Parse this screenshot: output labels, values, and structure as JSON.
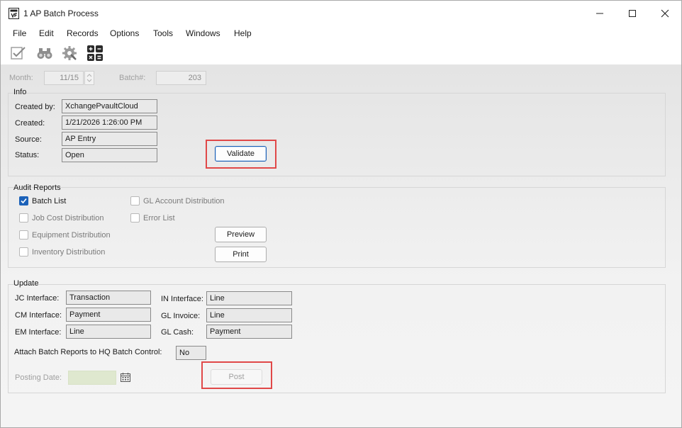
{
  "window": {
    "title": "1 AP Batch Process"
  },
  "menu": [
    "File",
    "Edit",
    "Records",
    "Options",
    "Tools",
    "Windows",
    "Help"
  ],
  "toolbar": {
    "icons": [
      "checklist-icon",
      "binoculars-icon",
      "gear-icon",
      "calculator-icon"
    ]
  },
  "header": {
    "month_label": "Month:",
    "month_value": "11/15",
    "batch_label": "Batch#:",
    "batch_value": "203"
  },
  "info": {
    "title": "Info",
    "created_by_label": "Created by:",
    "created_by": "XchangePvaultCloud",
    "created_label": "Created:",
    "created": "1/21/2026 1:26:00 PM",
    "source_label": "Source:",
    "source": "AP Entry",
    "status_label": "Status:",
    "status": "Open",
    "validate_label": "Validate"
  },
  "audit": {
    "title": "Audit Reports",
    "items": [
      {
        "label": "Batch List",
        "checked": true
      },
      {
        "label": "Job Cost Distribution",
        "checked": false
      },
      {
        "label": "Equipment Distribution",
        "checked": false
      },
      {
        "label": "Inventory Distribution",
        "checked": false
      },
      {
        "label": "GL Account Distribution",
        "checked": false
      },
      {
        "label": "Error List",
        "checked": false
      }
    ],
    "preview_label": "Preview",
    "print_label": "Print"
  },
  "update": {
    "title": "Update",
    "jc_label": "JC Interface:",
    "jc_value": "Transaction",
    "cm_label": "CM Interface:",
    "cm_value": "Payment",
    "em_label": "EM Interface:",
    "em_value": "Line",
    "in_label": "IN Interface:",
    "in_value": "Line",
    "gl_invoice_label": "GL Invoice:",
    "gl_invoice_value": "Line",
    "gl_cash_label": "GL Cash:",
    "gl_cash_value": "Payment",
    "attach_label": "Attach Batch Reports to HQ Batch Control:",
    "attach_value": "No",
    "posting_date_label": "Posting Date:",
    "posting_date_value": "",
    "post_label": "Post"
  },
  "colors": {
    "highlight": "#e04848",
    "checkbox": "#1c62b9",
    "button_focus": "#1a5fb4"
  }
}
